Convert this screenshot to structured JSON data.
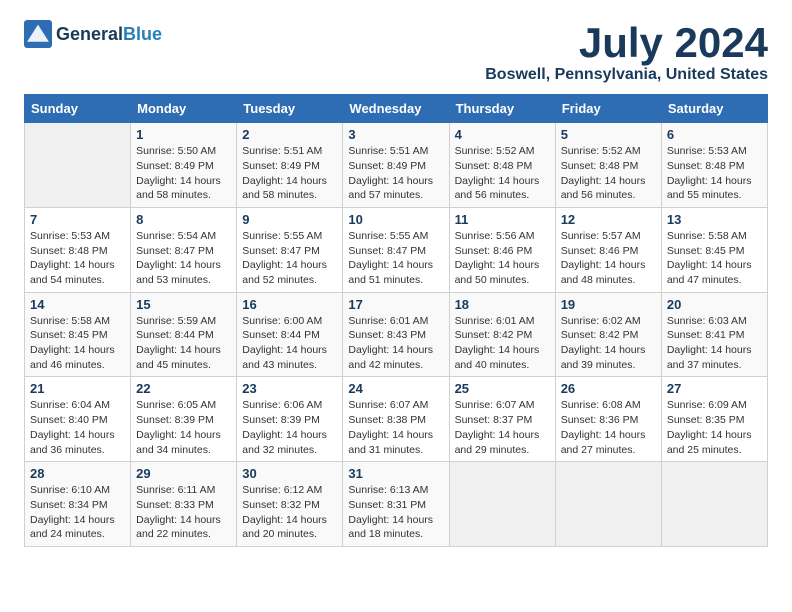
{
  "header": {
    "logo_general": "General",
    "logo_blue": "Blue",
    "title": "July 2024",
    "subtitle": "Boswell, Pennsylvania, United States"
  },
  "calendar": {
    "days_of_week": [
      "Sunday",
      "Monday",
      "Tuesday",
      "Wednesday",
      "Thursday",
      "Friday",
      "Saturday"
    ],
    "weeks": [
      [
        {
          "day": "",
          "info": ""
        },
        {
          "day": "1",
          "info": "Sunrise: 5:50 AM\nSunset: 8:49 PM\nDaylight: 14 hours\nand 58 minutes."
        },
        {
          "day": "2",
          "info": "Sunrise: 5:51 AM\nSunset: 8:49 PM\nDaylight: 14 hours\nand 58 minutes."
        },
        {
          "day": "3",
          "info": "Sunrise: 5:51 AM\nSunset: 8:49 PM\nDaylight: 14 hours\nand 57 minutes."
        },
        {
          "day": "4",
          "info": "Sunrise: 5:52 AM\nSunset: 8:48 PM\nDaylight: 14 hours\nand 56 minutes."
        },
        {
          "day": "5",
          "info": "Sunrise: 5:52 AM\nSunset: 8:48 PM\nDaylight: 14 hours\nand 56 minutes."
        },
        {
          "day": "6",
          "info": "Sunrise: 5:53 AM\nSunset: 8:48 PM\nDaylight: 14 hours\nand 55 minutes."
        }
      ],
      [
        {
          "day": "7",
          "info": "Sunrise: 5:53 AM\nSunset: 8:48 PM\nDaylight: 14 hours\nand 54 minutes."
        },
        {
          "day": "8",
          "info": "Sunrise: 5:54 AM\nSunset: 8:47 PM\nDaylight: 14 hours\nand 53 minutes."
        },
        {
          "day": "9",
          "info": "Sunrise: 5:55 AM\nSunset: 8:47 PM\nDaylight: 14 hours\nand 52 minutes."
        },
        {
          "day": "10",
          "info": "Sunrise: 5:55 AM\nSunset: 8:47 PM\nDaylight: 14 hours\nand 51 minutes."
        },
        {
          "day": "11",
          "info": "Sunrise: 5:56 AM\nSunset: 8:46 PM\nDaylight: 14 hours\nand 50 minutes."
        },
        {
          "day": "12",
          "info": "Sunrise: 5:57 AM\nSunset: 8:46 PM\nDaylight: 14 hours\nand 48 minutes."
        },
        {
          "day": "13",
          "info": "Sunrise: 5:58 AM\nSunset: 8:45 PM\nDaylight: 14 hours\nand 47 minutes."
        }
      ],
      [
        {
          "day": "14",
          "info": "Sunrise: 5:58 AM\nSunset: 8:45 PM\nDaylight: 14 hours\nand 46 minutes."
        },
        {
          "day": "15",
          "info": "Sunrise: 5:59 AM\nSunset: 8:44 PM\nDaylight: 14 hours\nand 45 minutes."
        },
        {
          "day": "16",
          "info": "Sunrise: 6:00 AM\nSunset: 8:44 PM\nDaylight: 14 hours\nand 43 minutes."
        },
        {
          "day": "17",
          "info": "Sunrise: 6:01 AM\nSunset: 8:43 PM\nDaylight: 14 hours\nand 42 minutes."
        },
        {
          "day": "18",
          "info": "Sunrise: 6:01 AM\nSunset: 8:42 PM\nDaylight: 14 hours\nand 40 minutes."
        },
        {
          "day": "19",
          "info": "Sunrise: 6:02 AM\nSunset: 8:42 PM\nDaylight: 14 hours\nand 39 minutes."
        },
        {
          "day": "20",
          "info": "Sunrise: 6:03 AM\nSunset: 8:41 PM\nDaylight: 14 hours\nand 37 minutes."
        }
      ],
      [
        {
          "day": "21",
          "info": "Sunrise: 6:04 AM\nSunset: 8:40 PM\nDaylight: 14 hours\nand 36 minutes."
        },
        {
          "day": "22",
          "info": "Sunrise: 6:05 AM\nSunset: 8:39 PM\nDaylight: 14 hours\nand 34 minutes."
        },
        {
          "day": "23",
          "info": "Sunrise: 6:06 AM\nSunset: 8:39 PM\nDaylight: 14 hours\nand 32 minutes."
        },
        {
          "day": "24",
          "info": "Sunrise: 6:07 AM\nSunset: 8:38 PM\nDaylight: 14 hours\nand 31 minutes."
        },
        {
          "day": "25",
          "info": "Sunrise: 6:07 AM\nSunset: 8:37 PM\nDaylight: 14 hours\nand 29 minutes."
        },
        {
          "day": "26",
          "info": "Sunrise: 6:08 AM\nSunset: 8:36 PM\nDaylight: 14 hours\nand 27 minutes."
        },
        {
          "day": "27",
          "info": "Sunrise: 6:09 AM\nSunset: 8:35 PM\nDaylight: 14 hours\nand 25 minutes."
        }
      ],
      [
        {
          "day": "28",
          "info": "Sunrise: 6:10 AM\nSunset: 8:34 PM\nDaylight: 14 hours\nand 24 minutes."
        },
        {
          "day": "29",
          "info": "Sunrise: 6:11 AM\nSunset: 8:33 PM\nDaylight: 14 hours\nand 22 minutes."
        },
        {
          "day": "30",
          "info": "Sunrise: 6:12 AM\nSunset: 8:32 PM\nDaylight: 14 hours\nand 20 minutes."
        },
        {
          "day": "31",
          "info": "Sunrise: 6:13 AM\nSunset: 8:31 PM\nDaylight: 14 hours\nand 18 minutes."
        },
        {
          "day": "",
          "info": ""
        },
        {
          "day": "",
          "info": ""
        },
        {
          "day": "",
          "info": ""
        }
      ]
    ]
  }
}
